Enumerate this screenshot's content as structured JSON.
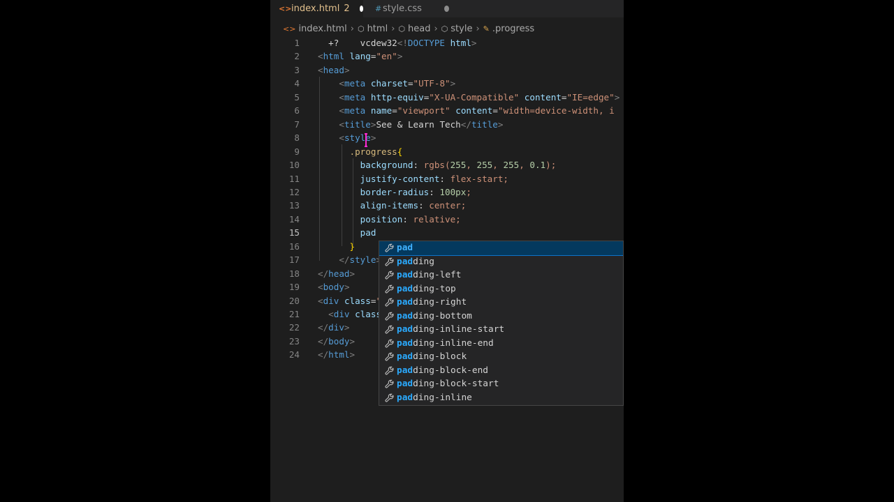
{
  "tabs": [
    {
      "icon": "<>",
      "label": "index.html",
      "count": "2",
      "state": "modified"
    },
    {
      "icon": "#",
      "label": "style.css",
      "state": "modified"
    }
  ],
  "breadcrumb": [
    "index.html",
    "html",
    "head",
    "style",
    ".progress"
  ],
  "lines": [
    {
      "n": "1",
      "text": "  +?    vcdew32<!DOCTYPE html>"
    },
    {
      "n": "2",
      "text": "<html lang=\"en\">"
    },
    {
      "n": "3",
      "text": "<head>"
    },
    {
      "n": "4",
      "text": "    <meta charset=\"UTF-8\">"
    },
    {
      "n": "5",
      "text": "    <meta http-equiv=\"X-UA-Compatible\" content=\"IE=edge\">"
    },
    {
      "n": "6",
      "text": "    <meta name=\"viewport\" content=\"width=device-width, i"
    },
    {
      "n": "7",
      "text": "    <title>See & Learn Tech</title>"
    },
    {
      "n": "8",
      "text": "    <style>"
    },
    {
      "n": "9",
      "text": "      .progress{"
    },
    {
      "n": "10",
      "text": "        background: rgbs(255, 255, 255, 0.1);"
    },
    {
      "n": "11",
      "text": "        justify-content: flex-start;"
    },
    {
      "n": "12",
      "text": "        border-radius: 100px;"
    },
    {
      "n": "13",
      "text": "        align-items: center;"
    },
    {
      "n": "14",
      "text": "        position: relative;"
    },
    {
      "n": "15",
      "text": "        pad"
    },
    {
      "n": "16",
      "text": "      }"
    },
    {
      "n": "17",
      "text": "    </style>"
    },
    {
      "n": "18",
      "text": "</head>"
    },
    {
      "n": "19",
      "text": "<body>"
    },
    {
      "n": "20",
      "text": "<div class=\"progress\">"
    },
    {
      "n": "21",
      "text": "  <div class=\"progress-value\"></div>"
    },
    {
      "n": "22",
      "text": "</div>"
    },
    {
      "n": "23",
      "text": "</body>"
    },
    {
      "n": "24",
      "text": "</html>"
    }
  ],
  "suggestions": {
    "typed": "pad",
    "items": [
      {
        "match": "pad",
        "rest": ""
      },
      {
        "match": "pad",
        "rest": "ding"
      },
      {
        "match": "pad",
        "rest": "ding-left"
      },
      {
        "match": "pad",
        "rest": "ding-top"
      },
      {
        "match": "pad",
        "rest": "ding-right"
      },
      {
        "match": "pad",
        "rest": "ding-bottom"
      },
      {
        "match": "pad",
        "rest": "ding-inline-start"
      },
      {
        "match": "pad",
        "rest": "ding-inline-end"
      },
      {
        "match": "pad",
        "rest": "ding-block"
      },
      {
        "match": "pad",
        "rest": "ding-block-end"
      },
      {
        "match": "pad",
        "rest": "ding-block-start"
      },
      {
        "match": "pad",
        "rest": "ding-inline"
      }
    ],
    "icon": "wrench-icon"
  },
  "colors": {
    "editor_bg": "#1e1e1e",
    "tag": "#569cd6",
    "attr": "#9cdcfe",
    "string": "#ce9178",
    "selection_bg": "#04395e",
    "match": "#2aaaff"
  }
}
